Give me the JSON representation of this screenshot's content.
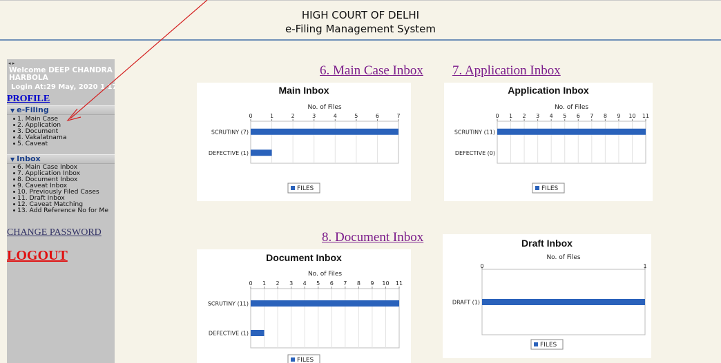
{
  "header": {
    "line1": "HIGH COURT OF DELHI",
    "line2": "e-Filing Management System"
  },
  "sidebar": {
    "collapse_glyph": "◂ ▸",
    "welcome": "Welcome DEEP CHANDRA HARBOLA",
    "login": "Login At:29 May, 2020 1 17",
    "profile": "PROFILE",
    "efiling": {
      "label": "e-Filing",
      "items": [
        "1. Main Case",
        "2. Application",
        "3. Document",
        "4. Vakalatnama",
        "5. Caveat"
      ]
    },
    "inbox": {
      "label": "Inbox",
      "items": [
        "6. Main Case Inbox",
        "7. Application Inbox",
        "8. Document Inbox",
        "9. Caveat Inbox",
        "10. Previously Filed Cases",
        "11. Draft Inbox",
        "12. Caveat Matching",
        "13. Add Reference No for Me"
      ]
    },
    "change_password": "CHANGE PASSWORD",
    "logout": "LOGOUT"
  },
  "sections": {
    "main_case_inbox": "6. Main Case Inbox",
    "application_inbox": "7. Application Inbox",
    "document_inbox": "8. Document Inbox"
  },
  "colors": {
    "bar": "#2a62bb",
    "annotation_arrow": "#d42020",
    "header_rule": "#6f8fb8",
    "link_visited": "#7a1a8a",
    "logout": "#e01010"
  },
  "chart_data": [
    {
      "type": "bar",
      "orientation": "horizontal",
      "title": "Main Inbox",
      "xlabel": "No. of Files",
      "categories": [
        "SCRUTINY (7)",
        "DEFECTIVE (1)"
      ],
      "series": [
        {
          "name": "FILES",
          "values": [
            7,
            1
          ]
        }
      ],
      "xlim": [
        0,
        7
      ],
      "ticks": [
        0,
        1,
        2,
        3,
        4,
        5,
        6,
        7
      ],
      "grid": true,
      "legend": "bottom"
    },
    {
      "type": "bar",
      "orientation": "horizontal",
      "title": "Application Inbox",
      "xlabel": "No. of Files",
      "categories": [
        "SCRUTINY (11)",
        "DEFECTIVE (0)"
      ],
      "series": [
        {
          "name": "FILES",
          "values": [
            11,
            0
          ]
        }
      ],
      "xlim": [
        0,
        11
      ],
      "ticks": [
        0,
        1,
        2,
        3,
        4,
        5,
        6,
        7,
        8,
        9,
        10,
        11
      ],
      "grid": true,
      "legend": "bottom"
    },
    {
      "type": "bar",
      "orientation": "horizontal",
      "title": "Document Inbox",
      "xlabel": "No. of Files",
      "categories": [
        "SCRUTINY (11)",
        "DEFECTIVE (1)"
      ],
      "series": [
        {
          "name": "FILES",
          "values": [
            11,
            1
          ]
        }
      ],
      "xlim": [
        0,
        11
      ],
      "ticks": [
        0,
        1,
        2,
        3,
        4,
        5,
        6,
        7,
        8,
        9,
        10,
        11
      ],
      "grid": true,
      "legend": "bottom"
    },
    {
      "type": "bar",
      "orientation": "horizontal",
      "title": "Draft Inbox",
      "xlabel": "No. of Files",
      "categories": [
        "DRAFT (1)"
      ],
      "series": [
        {
          "name": "FILES",
          "values": [
            1
          ]
        }
      ],
      "xlim": [
        0,
        1
      ],
      "ticks": [
        0,
        1
      ],
      "grid": false,
      "legend": "bottom"
    }
  ]
}
